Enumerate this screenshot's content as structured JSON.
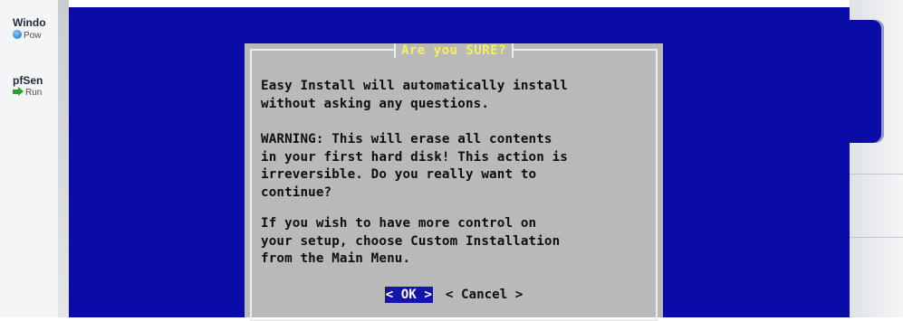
{
  "sidebar": {
    "items": [
      {
        "name": "Windo",
        "state": "Pow",
        "state_icon": "power-icon"
      },
      {
        "name": "pfSen",
        "state": "Run",
        "state_icon": "running-arrow-icon"
      }
    ]
  },
  "colors": {
    "guest_background": "#0b0ca8",
    "dialog_background": "#b9b9b9",
    "title_text": "#f5f25a",
    "selected_button": "#1414a8"
  },
  "dialog": {
    "title": "Are you SURE?",
    "paragraph1": "Easy Install will automatically install\nwithout asking any questions.",
    "paragraph2": "WARNING: This will erase all contents\nin your first hard disk! This action is\nirreversible. Do you really want to\ncontinue?",
    "paragraph3": "If you wish to have more control on\nyour setup, choose Custom Installation\nfrom the Main Menu.",
    "ok_label": "< OK >",
    "cancel_label": "< Cancel >"
  }
}
